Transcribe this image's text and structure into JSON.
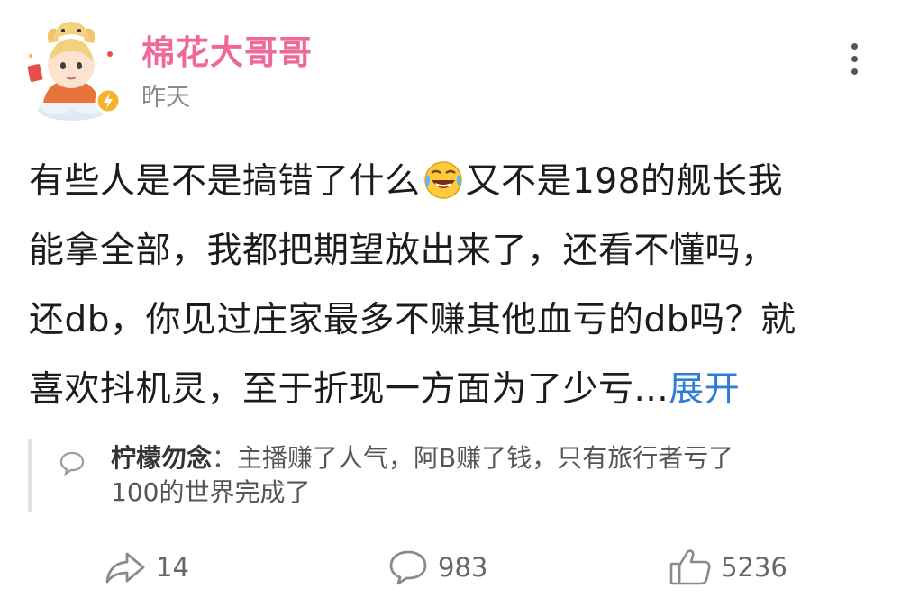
{
  "post": {
    "author": "棉花大哥哥",
    "time": "昨天",
    "content_lines": [
      "有些人是不是搞错了什么",
      "又不是198的舰长我",
      "能拿全部，我都把期望放出来了，还看不懂吗，",
      "还db，你见过庄家最多不赚其他血亏的db吗？就",
      "喜欢抖机灵，至于折现一方面为了少亏..."
    ],
    "expand_label": "展开",
    "emoji_name": "laughing-crying-emoji-icon"
  },
  "comment": {
    "author": "柠檬勿念",
    "separator": "：",
    "text_line1": "主播赚了人气，阿B赚了钱，只有旅行者亏了",
    "text_line2": "100的世界完成了"
  },
  "actions": {
    "share_count": "14",
    "comment_count": "983",
    "like_count": "5236"
  },
  "colors": {
    "author": "#f0689a",
    "link": "#2f7dd6",
    "meta": "#8a8a8a"
  },
  "icons": [
    "avatar",
    "more-vertical-icon",
    "comment-bubble-icon",
    "share-icon",
    "like-icon"
  ]
}
